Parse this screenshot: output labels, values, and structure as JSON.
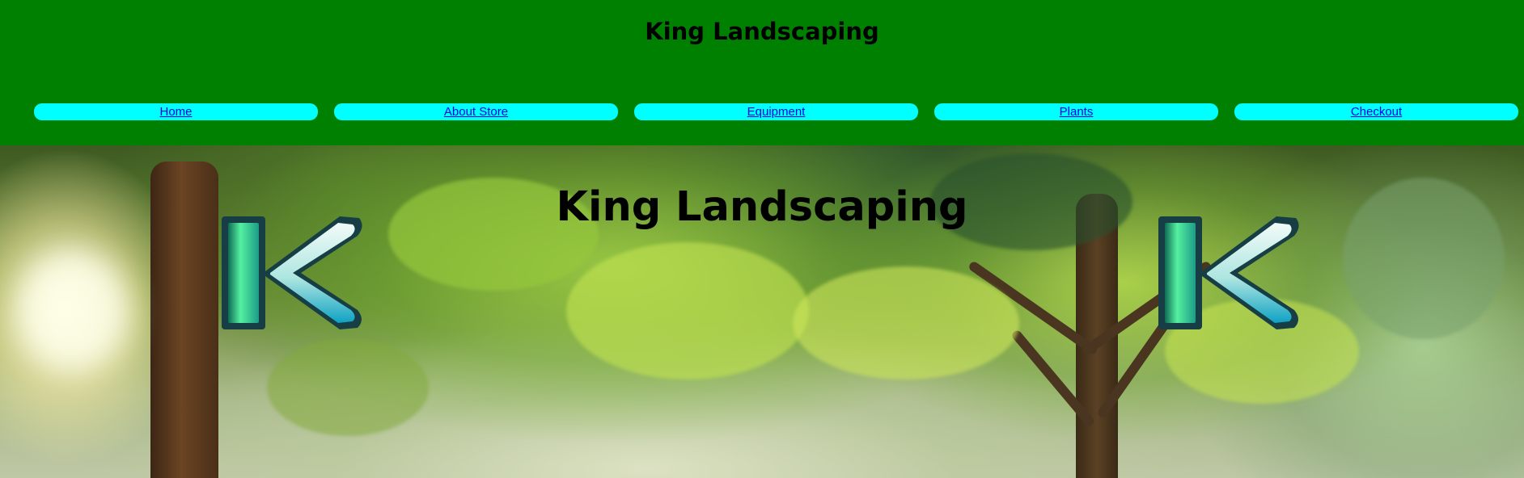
{
  "header": {
    "title": "King Landscaping",
    "background_color": "#008000"
  },
  "nav": {
    "items": [
      {
        "label": "Home"
      },
      {
        "label": "About Store"
      },
      {
        "label": "Equipment"
      },
      {
        "label": "Plants"
      },
      {
        "label": "Checkout"
      }
    ],
    "item_background_color": "#00ffff",
    "link_color": "#0000ee"
  },
  "hero": {
    "title": "King Landscaping",
    "background_image": "sunlit-forest-trees",
    "logos": [
      {
        "icon": "k-logo-icon",
        "letter": "K"
      },
      {
        "icon": "k-logo-icon",
        "letter": "K"
      }
    ]
  }
}
